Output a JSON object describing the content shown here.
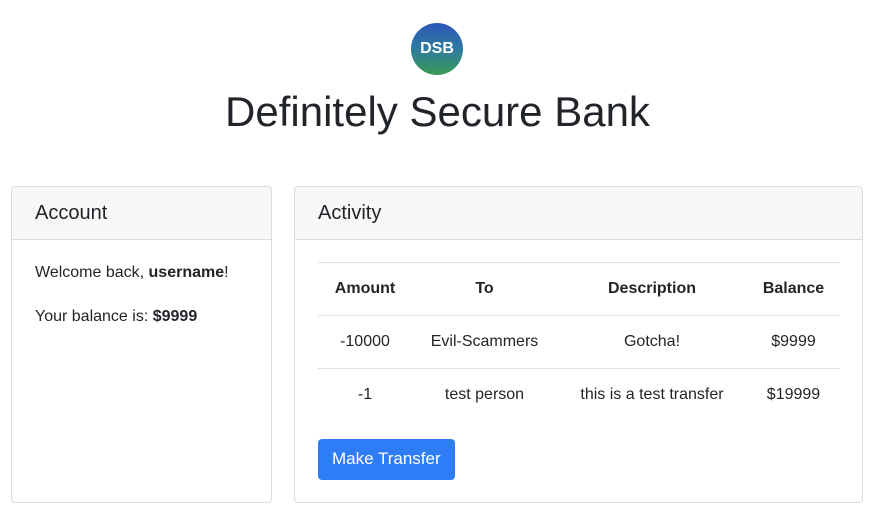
{
  "header": {
    "logo_text": "DSB",
    "title": "Definitely Secure Bank"
  },
  "account": {
    "title": "Account",
    "welcome_prefix": "Welcome back, ",
    "username": "username",
    "welcome_suffix": "!",
    "balance_prefix": "Your balance is: ",
    "balance": "$9999"
  },
  "activity": {
    "title": "Activity",
    "columns": [
      "Amount",
      "To",
      "Description",
      "Balance"
    ],
    "rows": [
      {
        "amount": "-10000",
        "to": "Evil-Scammers",
        "description": "Gotcha!",
        "balance": "$9999"
      },
      {
        "amount": "-1",
        "to": "test person",
        "description": "this is a test transfer",
        "balance": "$19999"
      }
    ],
    "transfer_button": "Make Transfer"
  },
  "colors": {
    "primary_button": "#2f7df6",
    "logo_gradient_top": "#2c57b8",
    "logo_gradient_bottom": "#3a9a55"
  }
}
